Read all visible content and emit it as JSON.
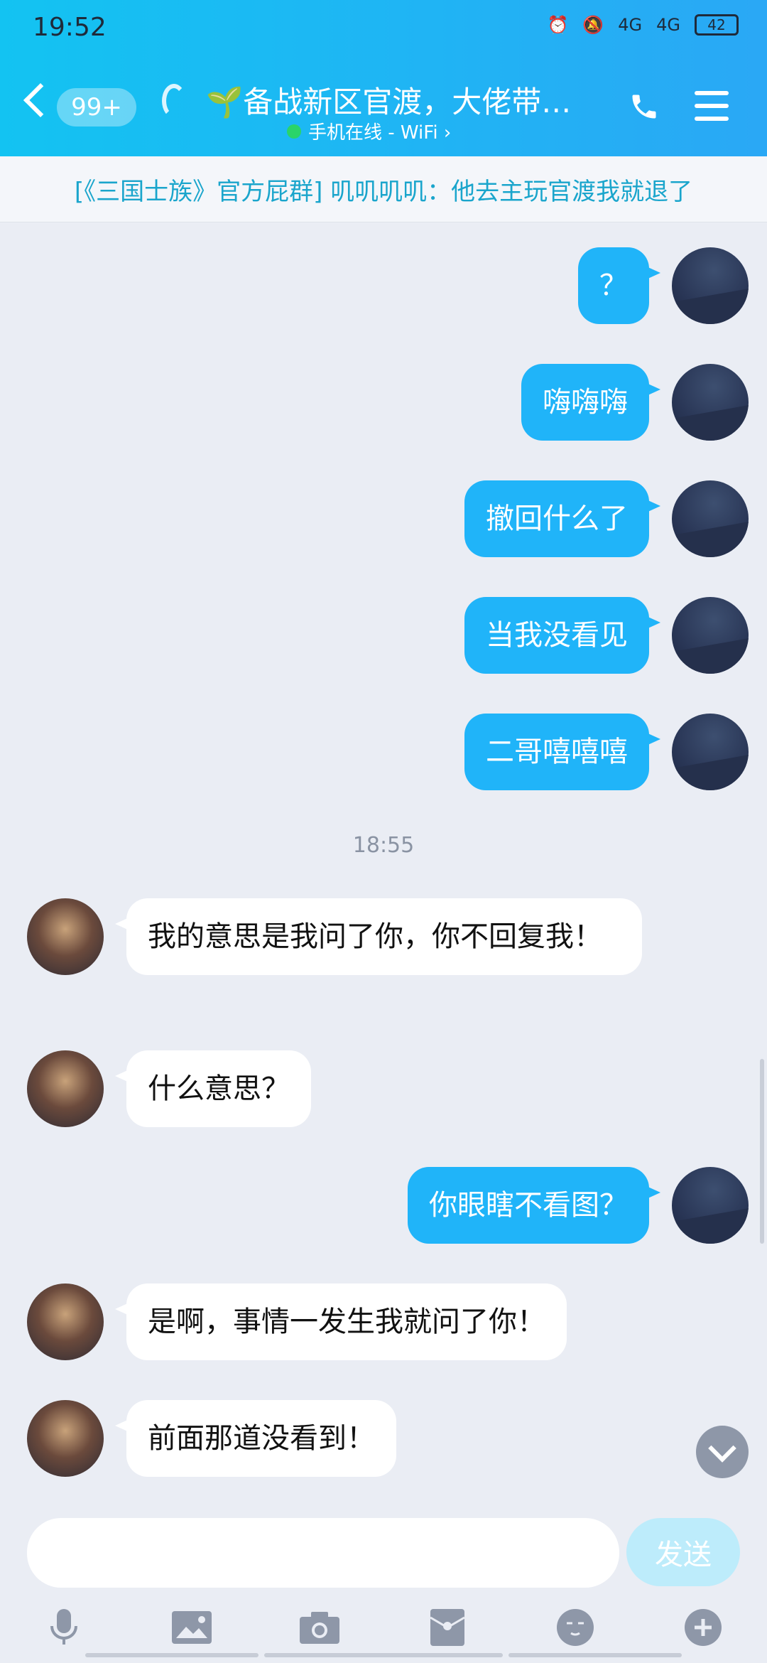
{
  "status_bar": {
    "time": "19:52",
    "network1": "4G",
    "network2": "4G",
    "battery": "42"
  },
  "header": {
    "unread_badge": "99+",
    "title": "🌱备战新区官渡，大佬带…",
    "subtitle": "手机在线 - WiFi ›"
  },
  "notice": "[《三国士族》官方屁群] 叽叽叽叽：他去主玩官渡我就退了",
  "messages": [
    {
      "side": "out",
      "text": "？"
    },
    {
      "side": "out",
      "text": "嗨嗨嗨"
    },
    {
      "side": "out",
      "text": "撤回什么了"
    },
    {
      "side": "out",
      "text": "当我没看见"
    },
    {
      "side": "out",
      "text": "二哥嘻嘻嘻"
    },
    {
      "side": "in",
      "text": "我的意思是我问了你，你不回复我！"
    },
    {
      "side": "in",
      "text": "什么意思？"
    },
    {
      "side": "out",
      "text": "你眼瞎不看图？"
    },
    {
      "side": "in",
      "text": "是啊，事情一发生我就问了你！"
    },
    {
      "side": "in",
      "text": "前面那道没看到！"
    }
  ],
  "time_separator": "18:55",
  "input": {
    "placeholder": ""
  },
  "send_label": "发送",
  "toolbar_icons": [
    "microphone-icon",
    "image-icon",
    "camera-icon",
    "red-packet-icon",
    "emoji-icon",
    "plus-icon"
  ],
  "colors": {
    "accent": "#20b4f9",
    "header": "#13c3f2",
    "notice_text": "#1aa5cc"
  }
}
